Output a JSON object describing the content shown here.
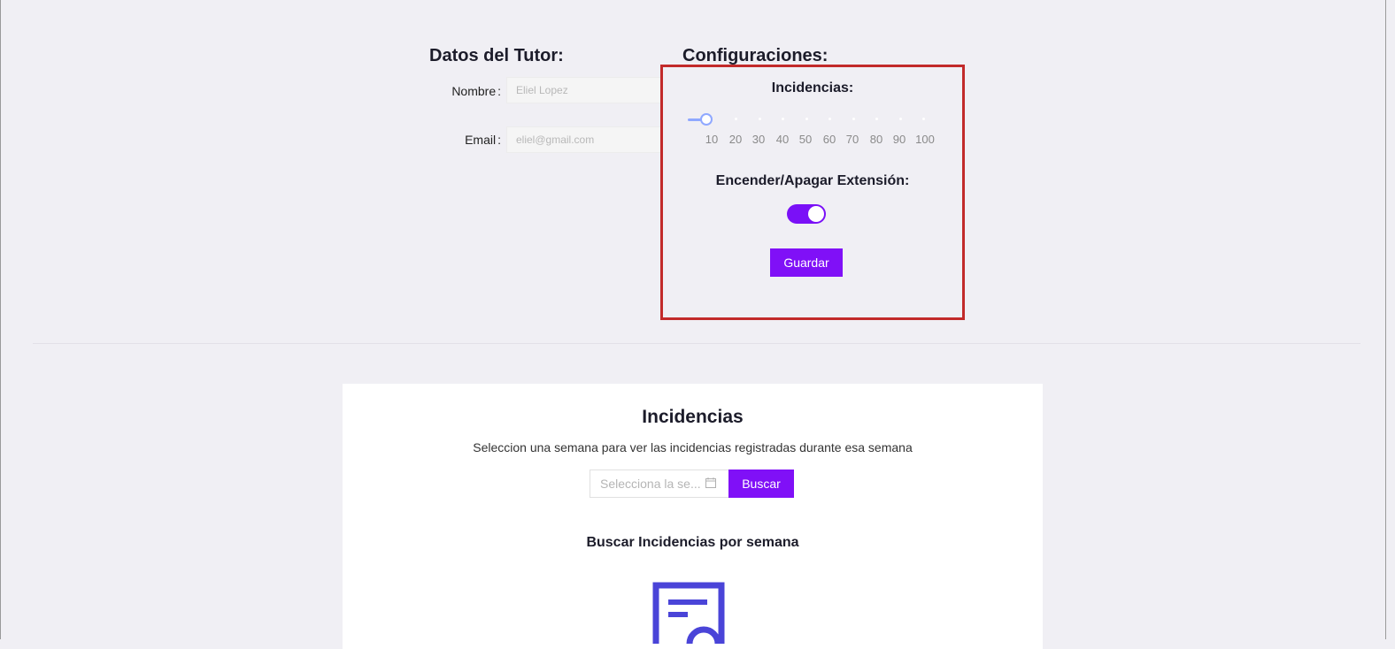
{
  "tutor": {
    "title": "Datos del Tutor:",
    "name_label": "Nombre",
    "name_value": "Eliel Lopez",
    "email_label": "Email",
    "email_value": "eliel@gmail.com"
  },
  "settings": {
    "title": "Configuraciones:",
    "incidences_label": "Incidencias:",
    "slider": {
      "value": 10,
      "min": 10,
      "max": 100,
      "marks": [
        "10",
        "20",
        "30",
        "40",
        "50",
        "60",
        "70",
        "80",
        "90",
        "100"
      ]
    },
    "toggle_label": "Encender/Apagar Extensión:",
    "toggle_on": true,
    "save_label": "Guardar",
    "accent_color": "#8010f7",
    "highlight_color": "#c22a2a"
  },
  "incidences": {
    "title": "Incidencias",
    "description": "Seleccion una semana para ver las incidencias registradas durante esa semana",
    "week_placeholder": "Selecciona la se...",
    "search_label": "Buscar",
    "subtitle": "Buscar Incidencias por semana"
  },
  "icons": [
    "calendar-icon",
    "document-search-icon"
  ]
}
